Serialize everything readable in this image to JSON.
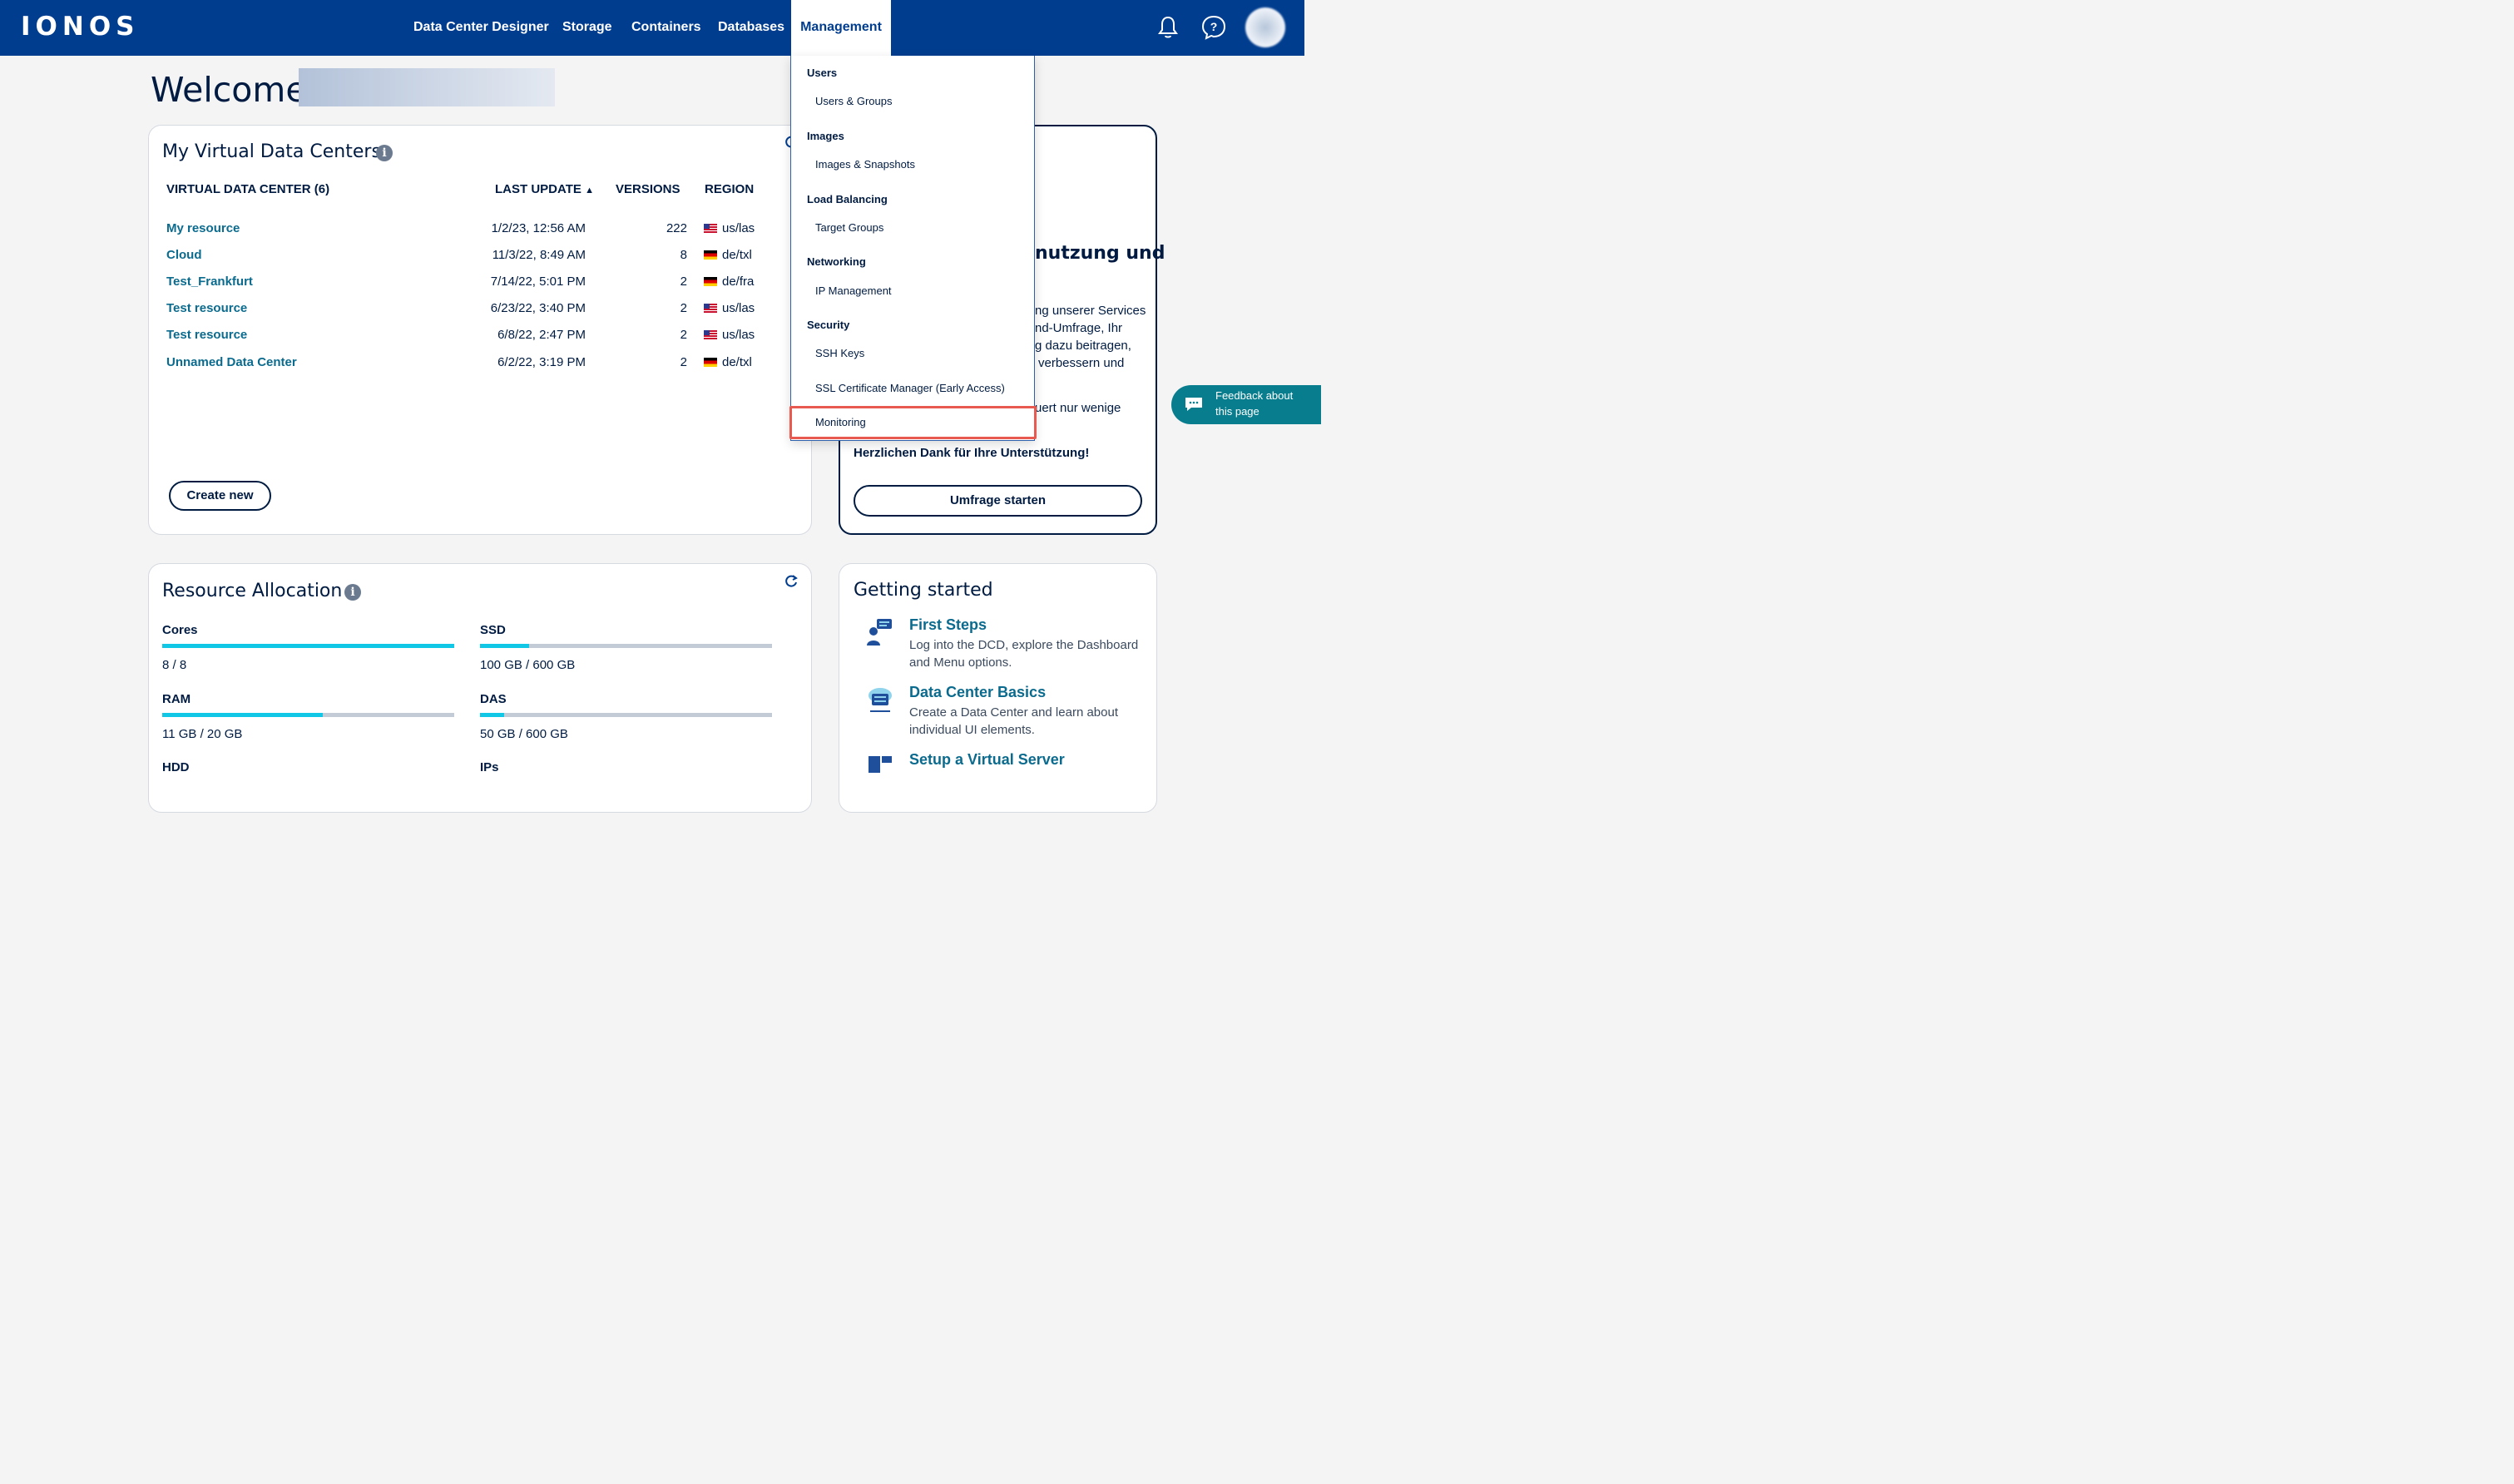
{
  "header": {
    "logo": "IONOS",
    "nav": [
      "Data Center Designer",
      "Storage",
      "Containers",
      "Databases",
      "Management"
    ],
    "active_nav": "Management",
    "icons": [
      "bell-icon",
      "help-chat-icon",
      "user-avatar"
    ]
  },
  "welcome": {
    "text": "Welcome"
  },
  "vdc_card": {
    "title": "My Virtual Data Centers",
    "columns": [
      "VIRTUAL DATA CENTER (6)",
      "LAST UPDATE",
      "VERSIONS",
      "REGION"
    ],
    "sort_indicator": "▲",
    "rows": [
      {
        "name": "My resource",
        "updated": "1/2/23, 12:56 AM",
        "versions": "222",
        "region": "us/las",
        "flag": "us"
      },
      {
        "name": "Cloud",
        "updated": "11/3/22, 8:49 AM",
        "versions": "8",
        "region": "de/txl",
        "flag": "de"
      },
      {
        "name": "Test_Frankfurt",
        "updated": "7/14/22, 5:01 PM",
        "versions": "2",
        "region": "de/fra",
        "flag": "de"
      },
      {
        "name": "Test resource",
        "updated": "6/23/22, 3:40 PM",
        "versions": "2",
        "region": "us/las",
        "flag": "us"
      },
      {
        "name": "Test resource",
        "updated": "6/8/22, 2:47 PM",
        "versions": "2",
        "region": "us/las",
        "flag": "us"
      },
      {
        "name": "Unnamed Data Center",
        "updated": "6/2/22, 3:19 PM",
        "versions": "2",
        "region": "de/txl",
        "flag": "de"
      }
    ],
    "create_button": "Create new"
  },
  "survey_card": {
    "heading_fragment": "nutzung und",
    "lines": [
      "ng unserer Services",
      "nd-Umfrage, Ihr",
      "g dazu beitragen,",
      "verbessern und",
      "uert nur wenige"
    ],
    "thanks": "Herzlichen Dank für Ihre Unterstützung!",
    "button": "Umfrage starten"
  },
  "resource_card": {
    "title": "Resource Allocation",
    "items": [
      {
        "label": "Cores",
        "value": "8 / 8",
        "fill": 1.0
      },
      {
        "label": "SSD",
        "value": "100 GB / 600 GB",
        "fill": 0.167
      },
      {
        "label": "RAM",
        "value": "11 GB / 20 GB",
        "fill": 0.55
      },
      {
        "label": "DAS",
        "value": "50 GB / 600 GB",
        "fill": 0.083
      },
      {
        "label": "HDD",
        "value": ""
      },
      {
        "label": "IPs",
        "value": ""
      }
    ]
  },
  "getting_started": {
    "title": "Getting started",
    "items": [
      {
        "title": "First Steps",
        "desc": "Log into the DCD, explore the Dashboard and Menu options."
      },
      {
        "title": "Data Center Basics",
        "desc": "Create a Data Center and learn about individual UI elements."
      },
      {
        "title": "Setup a Virtual Server",
        "desc": ""
      }
    ]
  },
  "management_menu": {
    "sections": [
      {
        "title": "Users",
        "items": [
          "Users & Groups"
        ]
      },
      {
        "title": "Images",
        "items": [
          "Images & Snapshots"
        ]
      },
      {
        "title": "Load Balancing",
        "items": [
          "Target Groups"
        ]
      },
      {
        "title": "Networking",
        "items": [
          "IP Management"
        ]
      },
      {
        "title": "Security",
        "items": [
          "SSH Keys",
          "SSL Certificate Manager (Early Access)",
          "Monitoring"
        ]
      }
    ],
    "highlighted_item": "Monitoring"
  },
  "feedback": {
    "label": "Feedback about this page"
  },
  "colors": {
    "brand": "#003d8f",
    "link": "#0b6b8e",
    "bar_fill": "#11c7e6",
    "highlight": "#e85a50",
    "feedback": "#087d8e"
  }
}
